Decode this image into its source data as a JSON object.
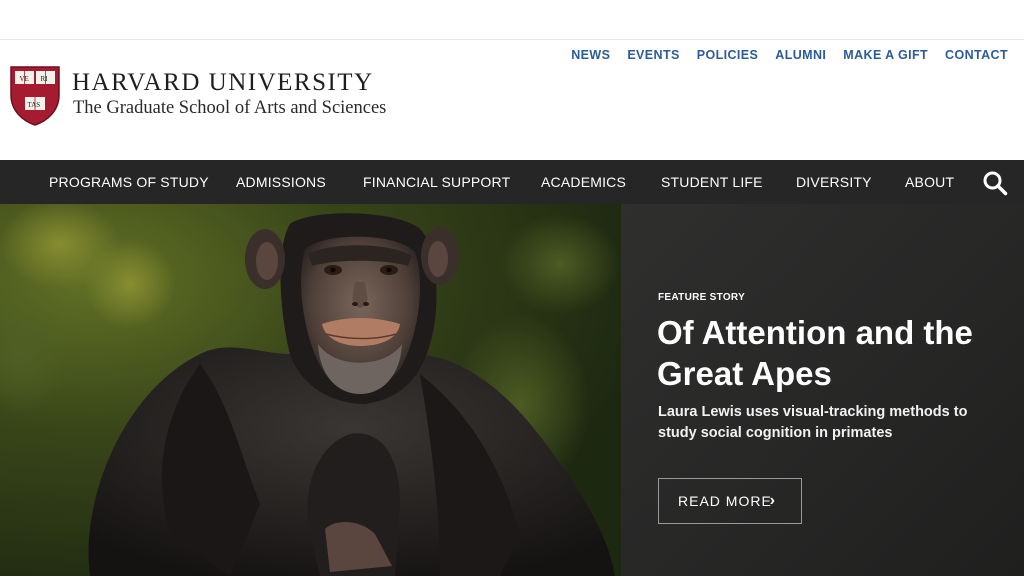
{
  "brand": {
    "title": "HARVARD UNIVERSITY",
    "subtitle": "The Graduate School of Arts and Sciences",
    "shield_text": [
      "VE",
      "RI",
      "TAS"
    ],
    "crimson": "#a51c30"
  },
  "utility_nav": [
    "NEWS",
    "EVENTS",
    "POLICIES",
    "ALUMNI",
    "MAKE A GIFT",
    "CONTACT"
  ],
  "main_nav": [
    "PROGRAMS OF STUDY",
    "ADMISSIONS",
    "FINANCIAL SUPPORT",
    "ACADEMICS",
    "STUDENT LIFE",
    "DIVERSITY",
    "ABOUT"
  ],
  "search_icon": "search-icon",
  "hero": {
    "eyebrow": "FEATURE STORY",
    "headline": "Of Attention and the Great Apes",
    "dek": "Laura Lewis uses visual-tracking methods to study social cognition in primates",
    "cta": "READ MORE",
    "cta_icon": "chevron-right-icon",
    "image_subject": "chimpanzee-photo"
  },
  "colors": {
    "utility_link": "#2b5c9a",
    "nav_bg": "#262626",
    "panel_bg": "#2b2b2a"
  }
}
